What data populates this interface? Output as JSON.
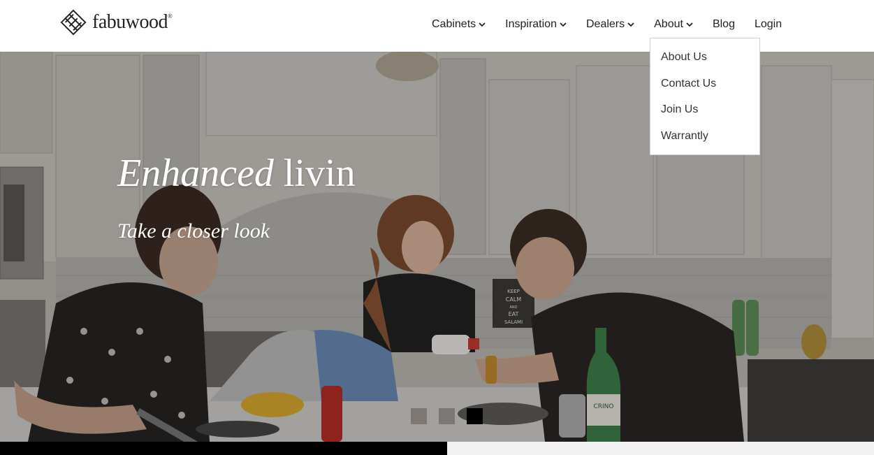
{
  "header": {
    "logo_text": "fabuwood",
    "logo_mark": "®"
  },
  "nav": {
    "items": [
      {
        "label": "Cabinets",
        "has_dropdown": true
      },
      {
        "label": "Inspiration",
        "has_dropdown": true
      },
      {
        "label": "Dealers",
        "has_dropdown": true
      },
      {
        "label": "About",
        "has_dropdown": true
      },
      {
        "label": "Blog",
        "has_dropdown": false
      },
      {
        "label": "Login",
        "has_dropdown": false
      }
    ]
  },
  "dropdown": {
    "items": [
      "About Us",
      "Contact Us",
      "Join Us",
      "Warrantly"
    ]
  },
  "hero": {
    "headline_italic": "Enhanced",
    "headline_rest": " livin",
    "subline": "Take a closer look",
    "slides_total": 3,
    "active_slide": 3,
    "poster_text": "KEEP CALM AND EAT SALAMI",
    "bottle_label": "CRINO"
  },
  "colors": {
    "nav_text": "#222222",
    "active_dot": "#000000",
    "inactive_dot": "#7d7873"
  }
}
